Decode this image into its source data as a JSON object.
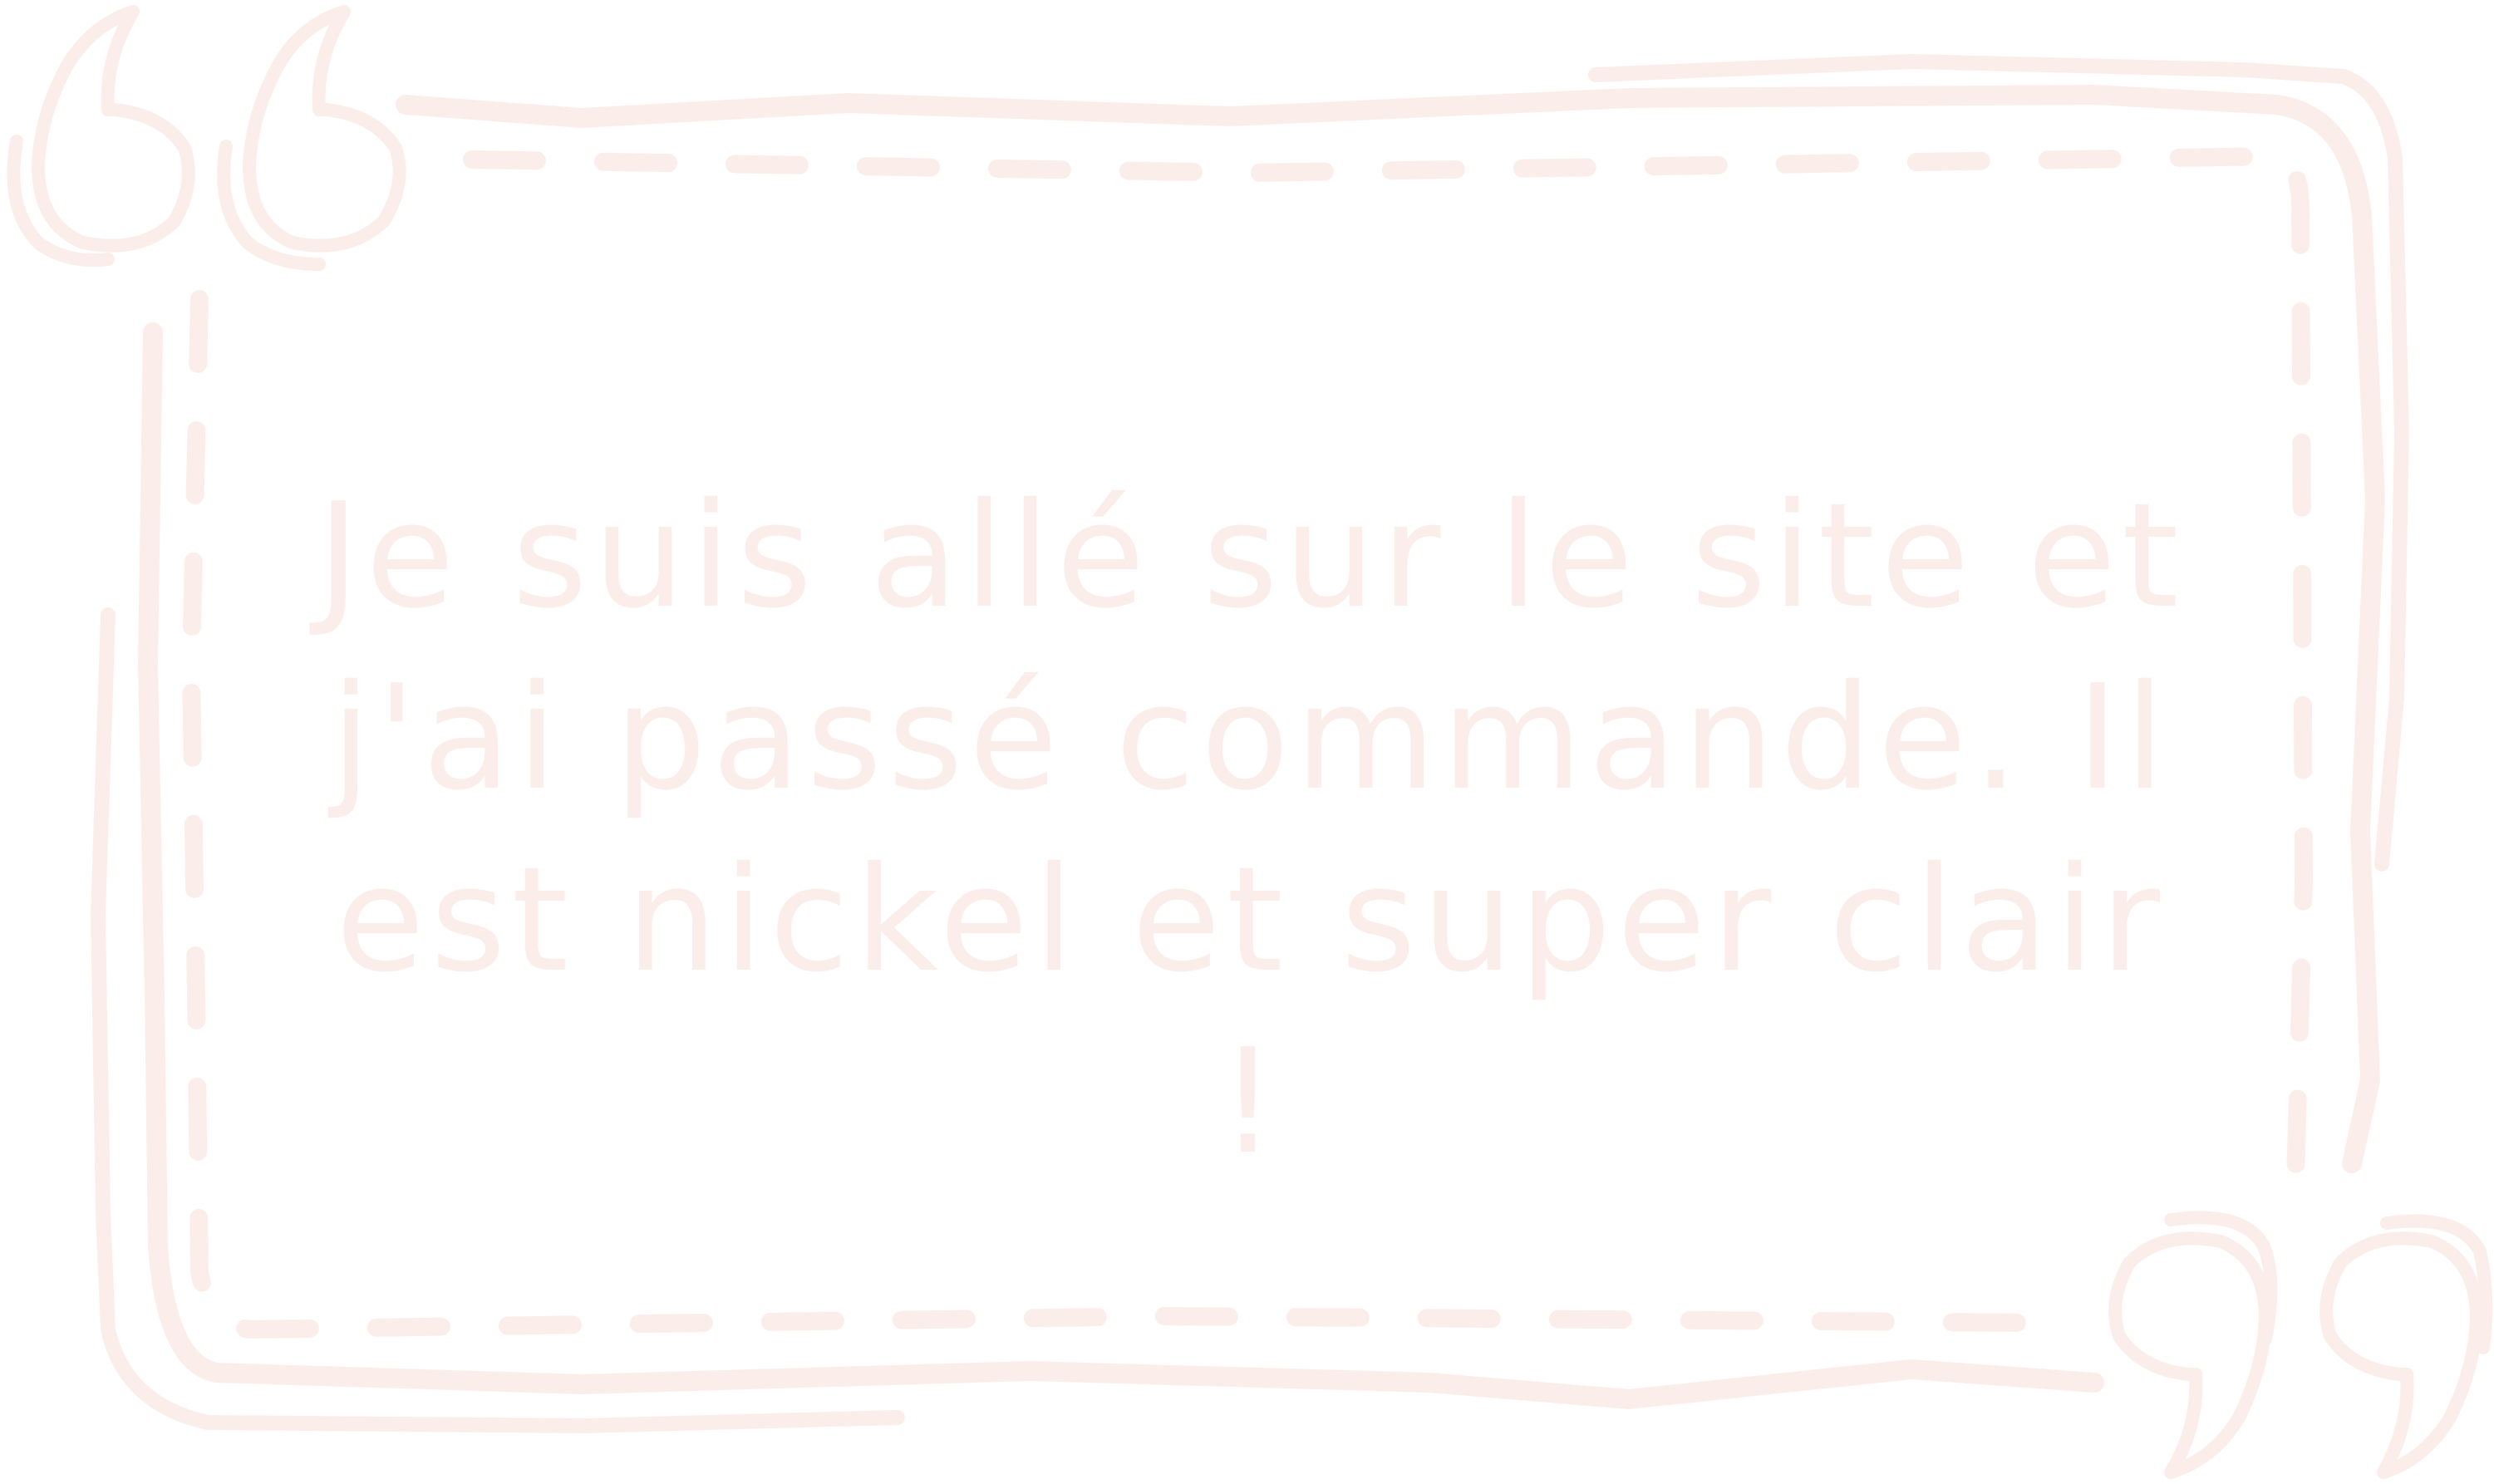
{
  "quote": {
    "text": "Je suis allé sur le site et j'ai passé commande. Il est nickel et super clair !"
  },
  "decor": {
    "open_quote_icon": "opening-double-quote",
    "close_quote_icon": "closing-double-quote",
    "frame_style": "hand-drawn double border with dashed inner line"
  },
  "colors": {
    "decor": "#fbeeea",
    "text": "#fbeeea",
    "background": "#ffffff"
  }
}
